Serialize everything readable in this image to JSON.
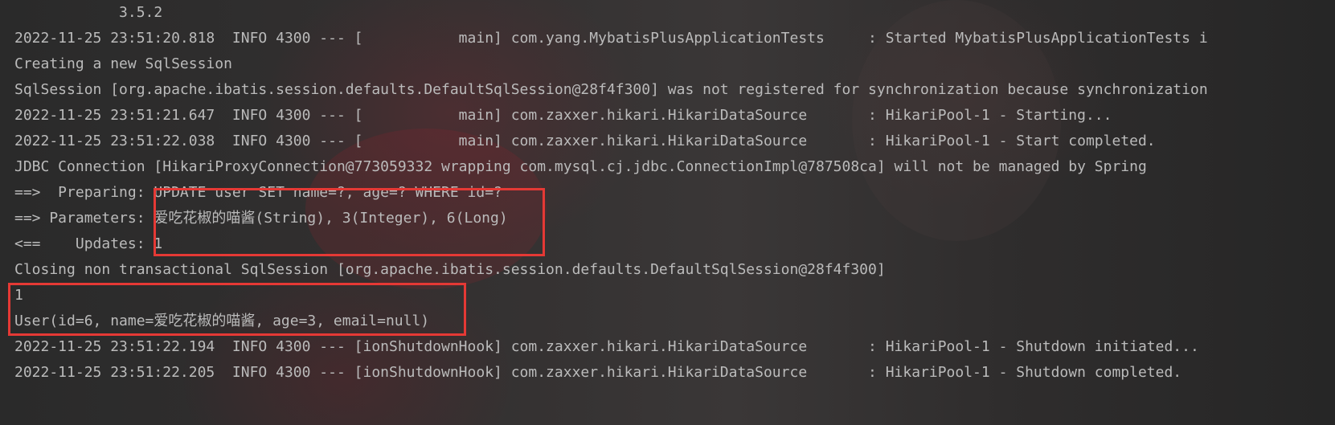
{
  "console": {
    "lines": [
      "            3.5.2",
      "2022-11-25 23:51:20.818  INFO 4300 --- [           main] com.yang.MybatisPlusApplicationTests     : Started MybatisPlusApplicationTests i",
      "Creating a new SqlSession",
      "SqlSession [org.apache.ibatis.session.defaults.DefaultSqlSession@28f4f300] was not registered for synchronization because synchronization",
      "2022-11-25 23:51:21.647  INFO 4300 --- [           main] com.zaxxer.hikari.HikariDataSource       : HikariPool-1 - Starting...",
      "2022-11-25 23:51:22.038  INFO 4300 --- [           main] com.zaxxer.hikari.HikariDataSource       : HikariPool-1 - Start completed.",
      "JDBC Connection [HikariProxyConnection@773059332 wrapping com.mysql.cj.jdbc.ConnectionImpl@787508ca] will not be managed by Spring",
      "==>  Preparing: UPDATE user SET name=?, age=? WHERE id=?",
      "==> Parameters: 爱吃花椒的喵酱(String), 3(Integer), 6(Long)",
      "<==    Updates: 1",
      "Closing non transactional SqlSession [org.apache.ibatis.session.defaults.DefaultSqlSession@28f4f300]",
      "1",
      "User(id=6, name=爱吃花椒的喵酱, age=3, email=null)",
      "2022-11-25 23:51:22.194  INFO 4300 --- [ionShutdownHook] com.zaxxer.hikari.HikariDataSource       : HikariPool-1 - Shutdown initiated...",
      "2022-11-25 23:51:22.205  INFO 4300 --- [ionShutdownHook] com.zaxxer.hikari.HikariDataSource       : HikariPool-1 - Shutdown completed."
    ]
  },
  "colors": {
    "text": "#bbbbbb",
    "highlight_box": "#e53935",
    "background": "#2b2b2b"
  }
}
